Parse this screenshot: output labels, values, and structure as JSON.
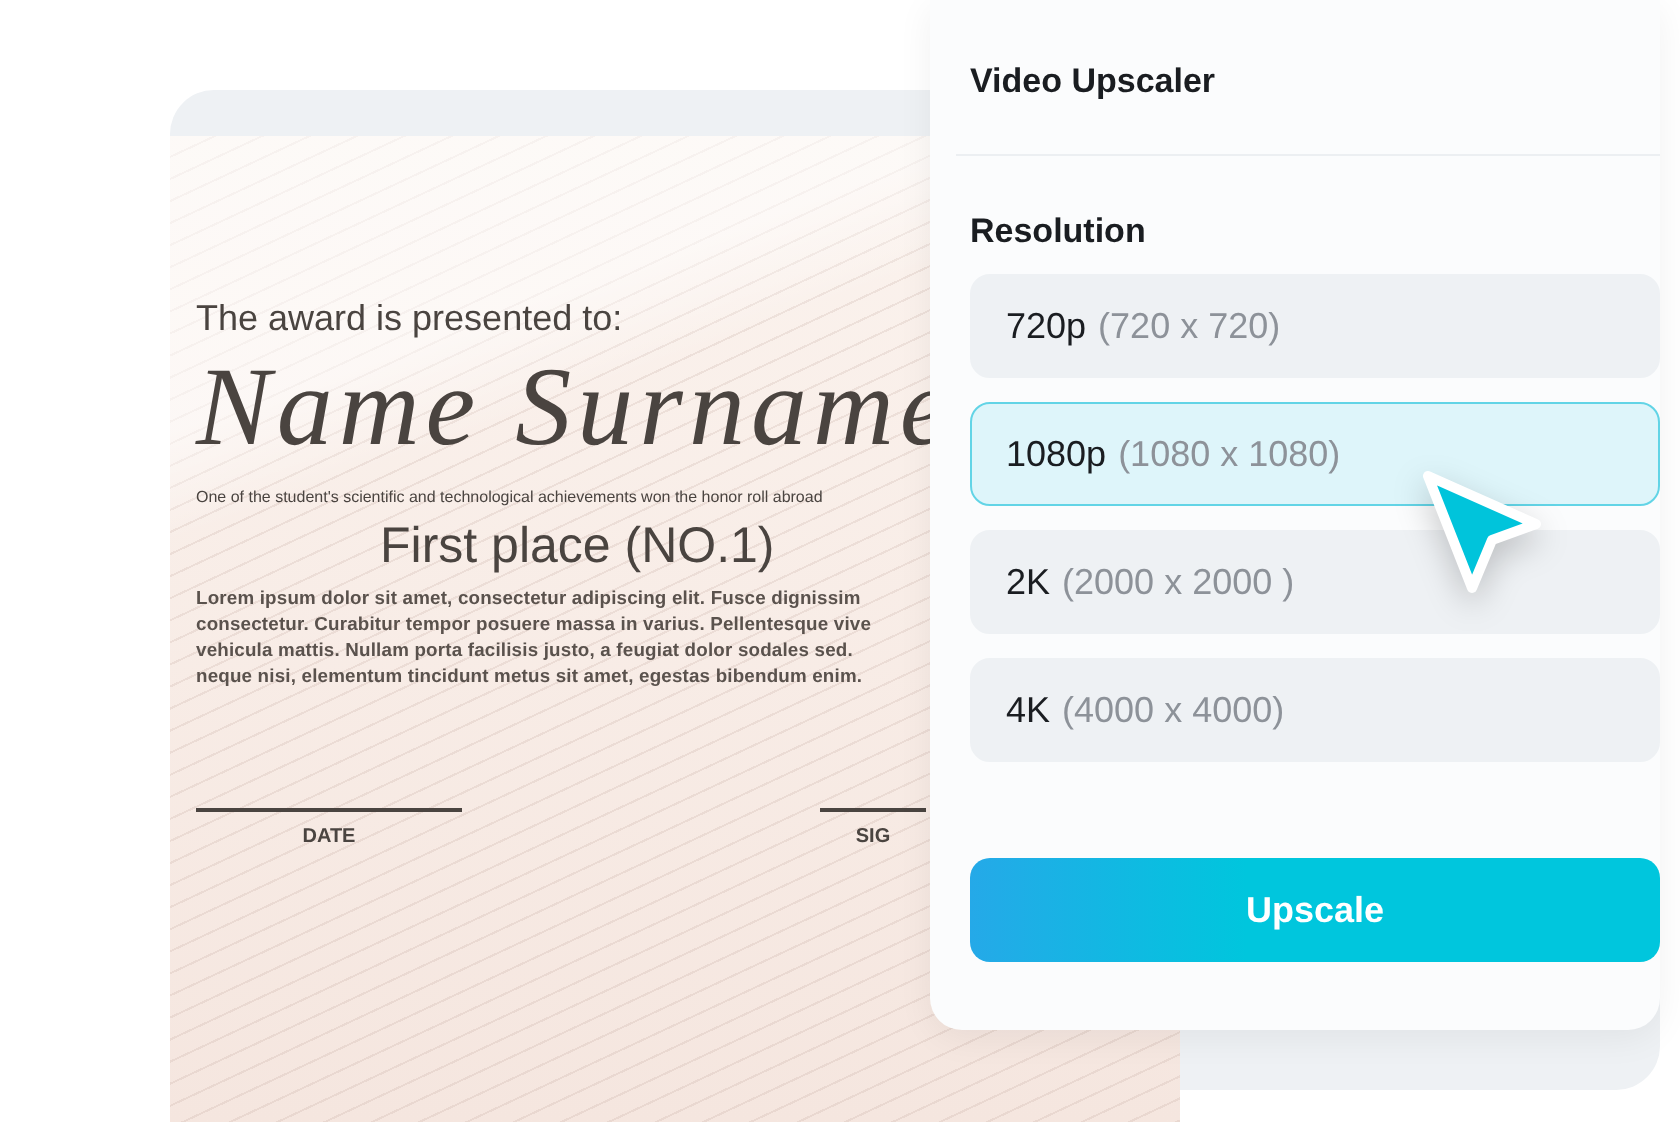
{
  "certificate": {
    "heading": "The award is presented to:",
    "name": "Name Surname",
    "citation": "One of the student's scientific and technological achievements won the honor roll abroad",
    "award": "First place (NO.1)",
    "body_lines": [
      "Lorem ipsum dolor sit amet, consectetur adipiscing elit. Fusce dignissim",
      "consectetur. Curabitur tempor posuere massa in varius. Pellentesque vive",
      "vehicula mattis. Nullam porta facilisis justo, a feugiat dolor sodales sed.",
      "neque nisi, elementum tincidunt metus sit amet, egestas bibendum enim."
    ],
    "signature_labels": [
      "DATE",
      "SIG"
    ]
  },
  "panel": {
    "title": "Video Upscaler",
    "section": "Resolution",
    "options": [
      {
        "label": "720p",
        "detail": "(720 x 720)",
        "selected": false
      },
      {
        "label": "1080p",
        "detail": "(1080 x 1080)",
        "selected": true
      },
      {
        "label": "2K",
        "detail": "(2000 x 2000 )",
        "selected": false
      },
      {
        "label": "4K",
        "detail": "(4000 x 4000)",
        "selected": false
      }
    ],
    "button": "Upscale"
  }
}
